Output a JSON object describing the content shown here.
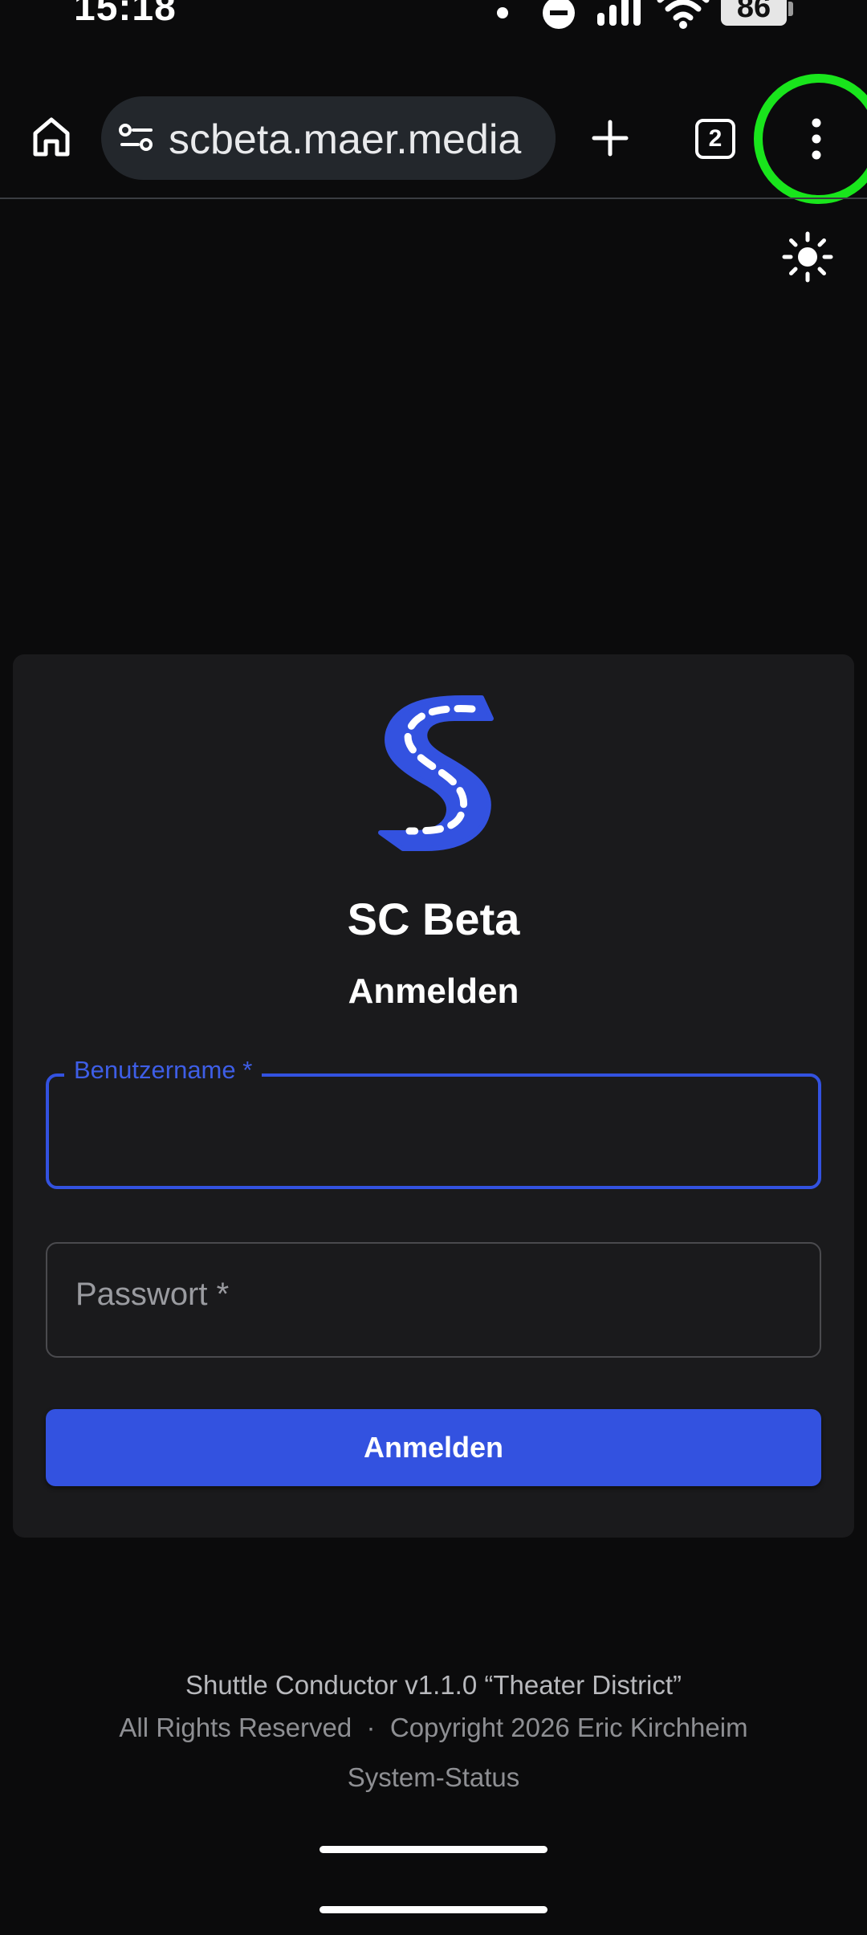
{
  "status_bar": {
    "time": "15:18",
    "battery_level": "86",
    "icons": [
      "notification-dot-icon",
      "do-not-disturb-icon",
      "signal-icon",
      "wifi-icon",
      "battery-icon"
    ]
  },
  "browser": {
    "url": "scbeta.maer.media",
    "tab_count": "2",
    "icons": [
      "home-icon",
      "site-settings-icon",
      "new-tab-icon",
      "tabs-icon",
      "more-menu-icon"
    ],
    "highlight_color": "#19e51c"
  },
  "page": {
    "theme_toggle_icon": "sun-icon",
    "card": {
      "logo_icon": "sc-road-logo-icon",
      "app_name": "SC Beta",
      "title": "Anmelden",
      "username_label": "Benutzername *",
      "password_placeholder": "Passwort *",
      "submit_label": "Anmelden"
    },
    "footer": {
      "version": "Shuttle Conductor v1.1.0 “Theater District”",
      "copyright": "All Rights Reserved  ·  Copyright 2026 Eric Kirchheim",
      "status_link": "System-Status"
    }
  },
  "colors": {
    "background": "#0b0b0c",
    "card": "#1a1a1c",
    "accent": "#3352e0",
    "text": "#ffffff",
    "muted": "#8e8f93"
  }
}
